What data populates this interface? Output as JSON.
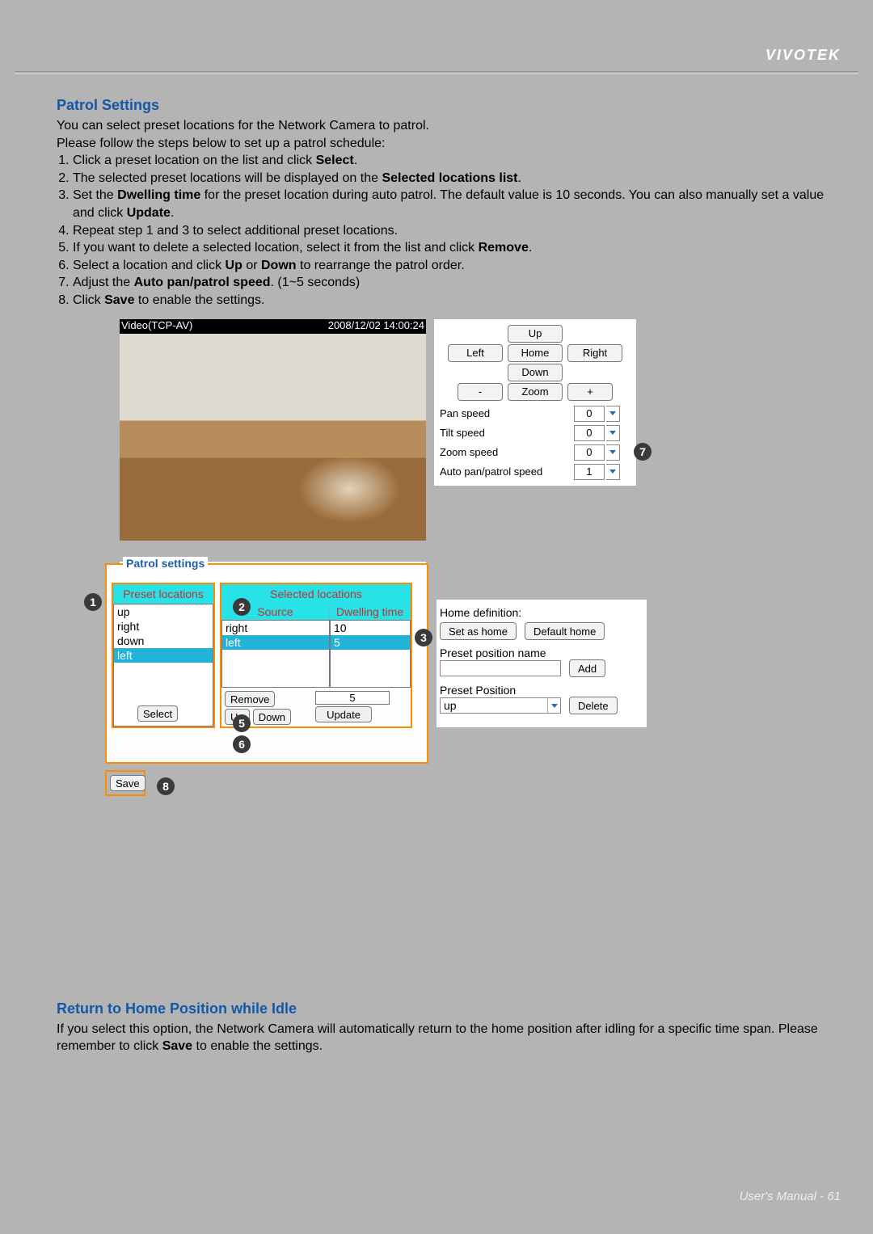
{
  "brand": "VIVOTEK",
  "footer_label": "User's Manual - ",
  "footer_page": "61",
  "section1_title": "Patrol Settings",
  "intro_line1": "You can select preset locations for the Network Camera to patrol.",
  "intro_line2": "Please follow the steps below to set up a patrol schedule:",
  "steps": {
    "s1a": "Click a preset location on the list and click ",
    "s1b": "Select",
    "s1c": ".",
    "s2a": "The selected preset locations will be displayed on the ",
    "s2b": "Selected locations list",
    "s2c": ".",
    "s3a": "Set the ",
    "s3b": "Dwelling time",
    "s3c": " for the preset location during auto patrol. The default value is 10 seconds. You can also manually set a value and click ",
    "s3d": "Update",
    "s3e": ".",
    "s4": "Repeat step 1 and 3 to select additional preset locations.",
    "s5a": "If you want to delete a selected location, select it from the list and click ",
    "s5b": "Remove",
    "s5c": ".",
    "s6a": "Select a location and click ",
    "s6b": "Up",
    "s6c": " or ",
    "s6d": "Down",
    "s6e": " to rearrange the patrol order.",
    "s7a": "Adjust the ",
    "s7b": "Auto pan/patrol speed",
    "s7c": ". (1~5 seconds)",
    "s8a": "Click ",
    "s8b": "Save",
    "s8c": " to enable the settings."
  },
  "video": {
    "title": "Video(TCP-AV)",
    "timestamp": "2008/12/02 14:00:24"
  },
  "ptz": {
    "up": "Up",
    "down": "Down",
    "left": "Left",
    "right": "Right",
    "home": "Home",
    "minus": "-",
    "zoom": "Zoom",
    "plus": "+",
    "pan_speed_label": "Pan speed",
    "pan_speed_value": "0",
    "tilt_speed_label": "Tilt speed",
    "tilt_speed_value": "0",
    "zoom_speed_label": "Zoom speed",
    "zoom_speed_value": "0",
    "auto_speed_label": "Auto pan/patrol speed",
    "auto_speed_value": "1"
  },
  "return_idle_label": "Return to home position while idle",
  "patrol": {
    "legend": "Patrol settings",
    "preset_header": "Preset locations",
    "presets": {
      "i0": "up",
      "i1": "right",
      "i2": "down",
      "i3": "left"
    },
    "selected_header": "Selected locations",
    "source_header": "Source",
    "dwelling_header": "Dwelling time",
    "rows": {
      "r0s": "right",
      "r0d": "10",
      "r1s": "left",
      "r1d": "5"
    },
    "select_btn": "Select",
    "remove_btn": "Remove",
    "up_btn": "Up",
    "down_btn": "Down",
    "dwelling_input": "5",
    "update_btn": "Update",
    "save_btn": "Save"
  },
  "home": {
    "definition_label": "Home definition:",
    "set_as_home": "Set as home",
    "default_home": "Default home",
    "preset_name_label": "Preset position name",
    "add_btn": "Add",
    "preset_position_label": "Preset Position",
    "preset_combo_value": "up",
    "delete_btn": "Delete"
  },
  "section2_title": "Return to Home Position while Idle",
  "section2_body_a": "If you select this option, the Network Camera will automatically return to the home position after idling for a specific time span. Please remember to click ",
  "section2_body_b": "Save",
  "section2_body_c": " to enable the settings.",
  "bubbles": {
    "n1": "1",
    "n2": "2",
    "n3": "3",
    "n5": "5",
    "n6": "6",
    "n7": "7",
    "n8": "8"
  }
}
